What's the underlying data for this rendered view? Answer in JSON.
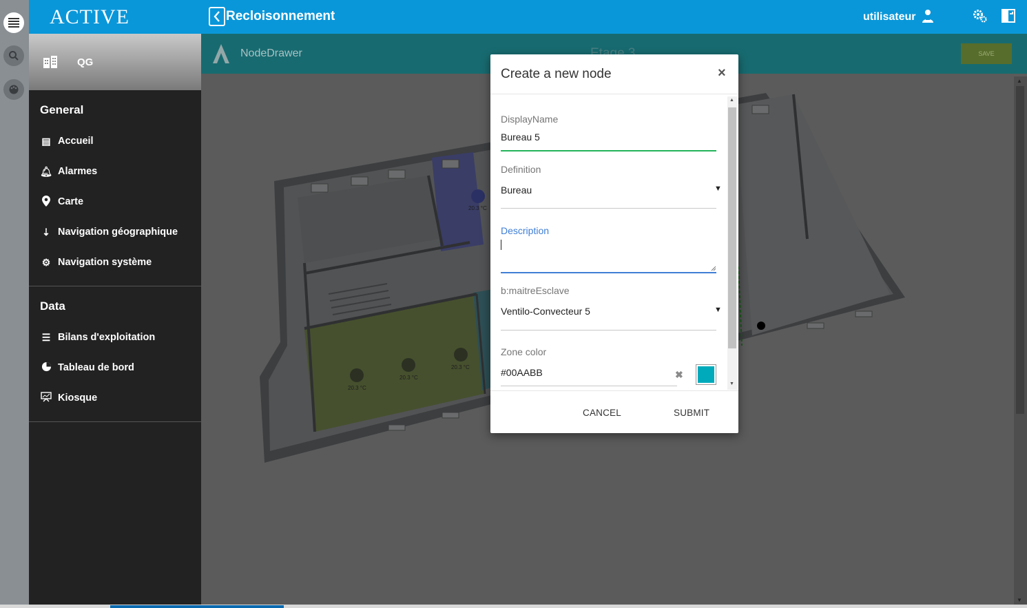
{
  "app": {
    "brand": "ACTIVE",
    "site": "QG",
    "page_title": "Recloisonnement",
    "user": "utilisateur"
  },
  "sidebar": {
    "general_title": "General",
    "general_items": [
      {
        "label": "Accueil",
        "icon": "home-icon"
      },
      {
        "label": "Alarmes",
        "icon": "bell-icon"
      },
      {
        "label": "Carte",
        "icon": "map-pin-icon"
      },
      {
        "label": "Navigation géographique",
        "icon": "geo-navigation-icon"
      },
      {
        "label": "Navigation système",
        "icon": "gears-icon"
      }
    ],
    "data_title": "Data",
    "data_items": [
      {
        "label": "Bilans d'exploitation",
        "icon": "list-icon"
      },
      {
        "label": "Tableau de bord",
        "icon": "pie-chart-icon"
      },
      {
        "label": "Kiosque",
        "icon": "presentation-icon"
      }
    ]
  },
  "toolbar": {
    "node_drawer": "NodeDrawer",
    "floor": "Etage 3",
    "save_label": "SAVE"
  },
  "plan": {
    "temps": [
      "20.3 °C",
      "20.3 °C",
      "20.3 °C",
      "20.3 °C"
    ]
  },
  "modal": {
    "title": "Create a new node",
    "close": "×",
    "display_name_label": "DisplayName",
    "display_name_value": "Bureau 5",
    "definition_label": "Definition",
    "definition_value": "Bureau",
    "description_label": "Description",
    "description_value": "",
    "master_label": "b:maitreEsclave",
    "master_value": "Ventilo-Convecteur 5",
    "zone_color_label": "Zone color",
    "zone_color_value": "#00AABB",
    "zone_color_hex": "#00AABB",
    "cancel_label": "CANCEL",
    "submit_label": "SUBMIT"
  },
  "colors": {
    "accent": "#0a97d9",
    "sidebar": "#222222",
    "subbar": "#176b70",
    "input_focus": "#3f7ed6",
    "input_valid": "#21b35a"
  }
}
